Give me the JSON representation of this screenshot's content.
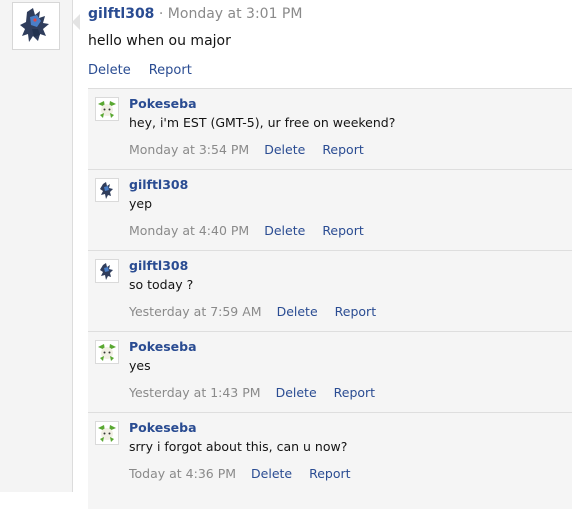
{
  "post": {
    "author": "gilftl308",
    "separator": " · ",
    "time": "Monday at 3:01 PM",
    "message": "hello when ou major",
    "actions": {
      "delete": "Delete",
      "report": "Report"
    }
  },
  "comments": [
    {
      "author": "Pokeseba",
      "avatar": "whimsicott-avatar-icon",
      "text": "hey, i'm EST (GMT-5), ur free on weekend?",
      "time": "Monday at 3:54 PM",
      "delete": "Delete",
      "report": "Report"
    },
    {
      "author": "gilftl308",
      "avatar": "zekrom-avatar-icon",
      "text": "yep",
      "time": "Monday at 4:40 PM",
      "delete": "Delete",
      "report": "Report"
    },
    {
      "author": "gilftl308",
      "avatar": "zekrom-avatar-icon",
      "text": "so today ?",
      "time": "Yesterday at 7:59 AM",
      "delete": "Delete",
      "report": "Report"
    },
    {
      "author": "Pokeseba",
      "avatar": "whimsicott-avatar-icon",
      "text": "yes",
      "time": "Yesterday at 1:43 PM",
      "delete": "Delete",
      "report": "Report"
    },
    {
      "author": "Pokeseba",
      "avatar": "whimsicott-avatar-icon",
      "text": "srry i forgot about this, can u now?",
      "time": "Today at 4:36 PM",
      "delete": "Delete",
      "report": "Report"
    }
  ],
  "colors": {
    "link": "#2a4c92",
    "meta": "#8a8a8a",
    "comment_bg": "#f5f5f5",
    "strip_bg": "#f4f4f4"
  }
}
